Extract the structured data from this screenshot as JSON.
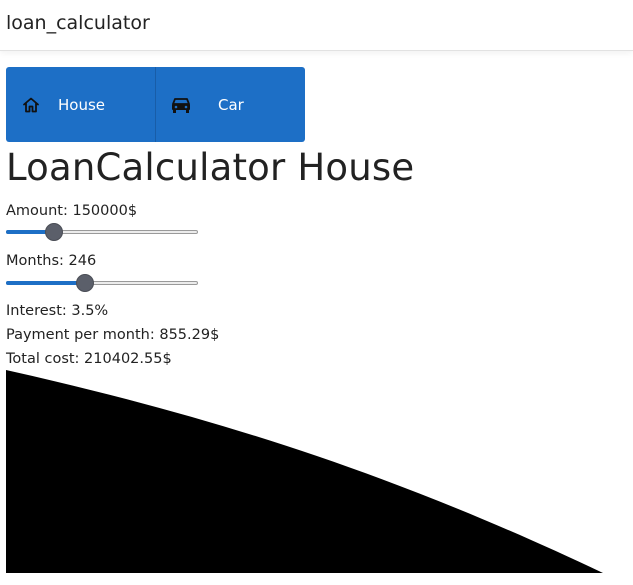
{
  "window": {
    "title": "loan_calculator"
  },
  "tabs": [
    {
      "label": "House",
      "icon": "home-icon"
    },
    {
      "label": "Car",
      "icon": "car-icon"
    }
  ],
  "page": {
    "title": "LoanCalculator House"
  },
  "amount": {
    "label": "Amount: 150000$",
    "fraction": 0.25
  },
  "months": {
    "label": "Months: 246",
    "fraction": 0.41
  },
  "results": {
    "interest": "Interest: 3.5%",
    "payment": "Payment per month: 855.29$",
    "total": "Total cost: 210402.55$"
  },
  "colors": {
    "accent": "#1d6fc6",
    "thumb": "#5b5f6a",
    "chart": "#000000"
  }
}
